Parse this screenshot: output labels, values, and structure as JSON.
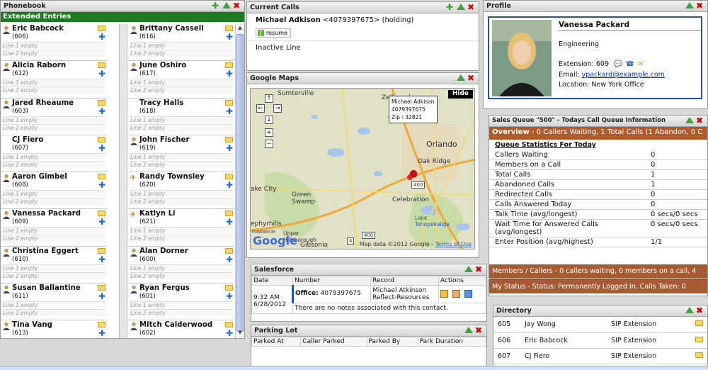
{
  "colors": {
    "accent_green": "#1e7a1e",
    "queue_brown": "#b05a2a",
    "profile_border": "#1f57a8"
  },
  "phonebook": {
    "title": "Phonebook",
    "section": "Extended Entries",
    "line1": "Line 1 empty",
    "line2": "Line 2 empty",
    "left": [
      {
        "name": "Eric Babcock",
        "ext": "(606)",
        "status": "person"
      },
      {
        "name": "Alicia Raborn",
        "ext": "(612)",
        "status": "person"
      },
      {
        "name": "Jared Rheaume",
        "ext": "(603)",
        "status": "person"
      },
      {
        "name": "CJ Fiero",
        "ext": "(607)",
        "status": "dnd"
      },
      {
        "name": "Aaron Gimbel",
        "ext": "(608)",
        "status": "person"
      },
      {
        "name": "Vanessa Packard",
        "ext": "(609)",
        "status": "person"
      },
      {
        "name": "Christina Eggert",
        "ext": "(610)",
        "status": "person"
      },
      {
        "name": "Susan Ballantine",
        "ext": "(611)",
        "status": "person"
      },
      {
        "name": "Tina Vang",
        "ext": "(613)",
        "status": "person"
      }
    ],
    "right": [
      {
        "name": "Brittany Cassell",
        "ext": "(616)",
        "status": "person"
      },
      {
        "name": "June Oshiro",
        "ext": "(617)",
        "status": "person"
      },
      {
        "name": "Tracy Halls",
        "ext": "(618)",
        "status": "dnd"
      },
      {
        "name": "John Fischer",
        "ext": "(619)",
        "status": "person"
      },
      {
        "name": "Randy Townsley",
        "ext": "(620)",
        "status": "away"
      },
      {
        "name": "Katlyn Li",
        "ext": "(621)",
        "status": "away"
      },
      {
        "name": "Alan Dorner",
        "ext": "(600)",
        "status": "person"
      },
      {
        "name": "Ryan Fergus",
        "ext": "(601)",
        "status": "person"
      },
      {
        "name": "Mitch Calderwood",
        "ext": "(602)",
        "status": "person"
      }
    ]
  },
  "current_calls": {
    "title": "Current Calls",
    "caller_name": "Michael Adkison",
    "caller_detail": "<4079397675> (holding)",
    "resume_label": "resume",
    "inactive_label": "Inactive Line"
  },
  "map": {
    "title": "Google Maps",
    "hide_label": "Hide",
    "info_name": "Michael Adkison",
    "info_phone": "4079397675",
    "info_zip": "Zip : 32821",
    "labels": {
      "sumterville": "Sumterville",
      "zellwood": "Zellwood",
      "orlando": "Orlando",
      "oak_ridge": "Oak Ridge",
      "green_swamp": "Green\nSwamp",
      "lake_city": "ake City",
      "celebration": "Celebration",
      "lake_tohopekaliga": "Lake\nTohopekaliga",
      "ephyrhills": "ephyrhills",
      "hillsborough": "Upper\nHillsborough",
      "gibsonia": "Gibsonia",
      "road400": "400",
      "road4": "4"
    },
    "powered": "POWERED BY",
    "google": "Google",
    "footer": "Map data ©2012 Google - ",
    "terms": "Terms of Use"
  },
  "salesforce": {
    "title": "Salesforce",
    "headers": [
      "Date",
      "Number",
      "Record",
      "Actions"
    ],
    "time": "9:32 AM",
    "date": "6/28/2012",
    "number_label": "Office:",
    "number": "4079397675",
    "record_name": "Michael Atkinson",
    "record_org": "Reflect-Resources",
    "notes": "There are no notes associated with this contact."
  },
  "parking": {
    "title": "Parking Lot",
    "headers": [
      "Parked At",
      "Caller Parked",
      "Parked By",
      "Park Duration"
    ]
  },
  "profile": {
    "title": "Profile",
    "name": "Vanessa Packard",
    "department": "Engineering",
    "extension": "Extension: 609",
    "email_label": "Email: ",
    "email": "vpackard@example.com",
    "location": "Location: New York Office"
  },
  "queue": {
    "title": "Sales Queue \"500\" - Todays Call Queue Information",
    "overview_label": "Overview",
    "overview_text": " - 0 Callers Waiting, 1 Total Calls (1 Abandon, 0 C",
    "stats_title": "Queue Statistics For Today",
    "stats": [
      {
        "label": "Callers Waiting",
        "value": "0"
      },
      {
        "label": "Members on a Call",
        "value": "0"
      },
      {
        "label": "Total Calls",
        "value": "1"
      },
      {
        "label": "Abandoned Calls",
        "value": "1"
      },
      {
        "label": "Redirected Calls",
        "value": "0"
      },
      {
        "label": "Calls Answered Today",
        "value": "0"
      },
      {
        "label": "Talk Time (avg/longest)",
        "value": "0 secs/0 secs"
      },
      {
        "label": "Wait Time for Answered Calls (avg/longest)",
        "value": "0 secs/0 secs"
      },
      {
        "label": "Enter Position (avg/highest)",
        "value": "1/1"
      }
    ],
    "members_bar": "Members / Callers - 0  callers waiting, 0  members on a call, 4",
    "status_bar": "My Status - Status: Permanently Logged In, Calls Taken: 0"
  },
  "directory": {
    "title": "Directory",
    "rows": [
      {
        "ext": "605",
        "name": "Jay Wong",
        "type": "SIP Extension"
      },
      {
        "ext": "606",
        "name": "Eric Babcock",
        "type": "SIP Extension"
      },
      {
        "ext": "607",
        "name": "CJ Fiero",
        "type": "SIP Extension"
      }
    ]
  }
}
